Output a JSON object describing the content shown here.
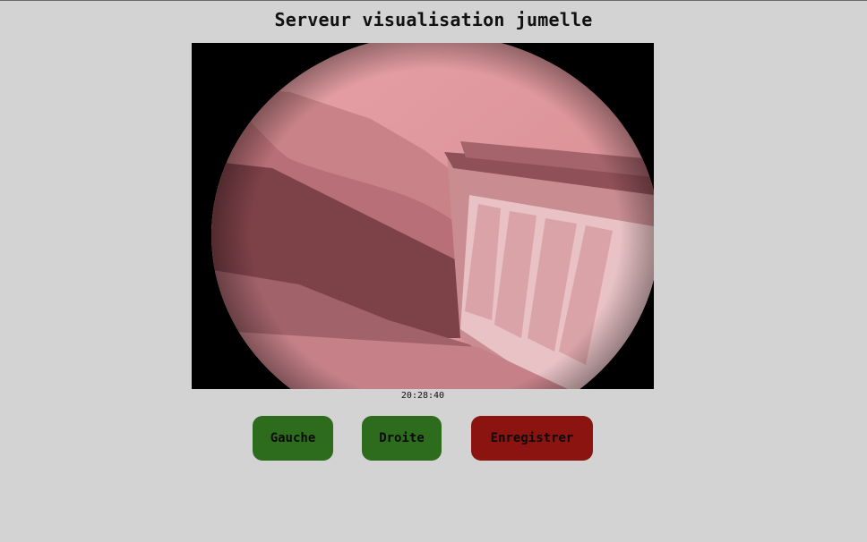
{
  "page": {
    "title": "Serveur visualisation jumelle"
  },
  "viewer": {
    "image_label": "camera-feed",
    "timestamp": "20:28:40"
  },
  "controls": {
    "left_label": "Gauche",
    "right_label": "Droite",
    "record_label": "Enregistrer"
  },
  "colors": {
    "background": "#d3d3d3",
    "direction_button": "#2d6b1d",
    "record_button": "#8b1410",
    "feed_tint": "#d98a8e"
  }
}
